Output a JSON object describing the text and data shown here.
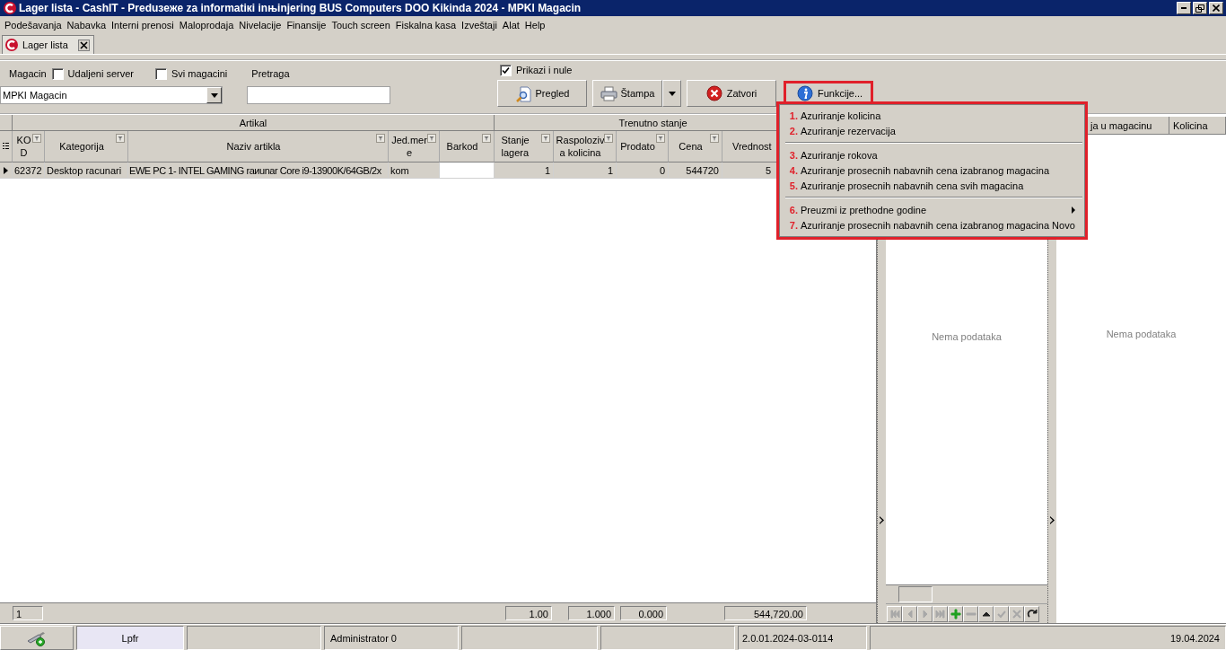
{
  "window": {
    "title": "Lager lista - CashIT - Preduзeжe za informatiкi inњinjering BUS Computers DOO Kikinda 2024 - MPKI Magacin"
  },
  "menu_bar": [
    "Podešavanja",
    "Nabavka",
    "Interni prenosi",
    "Maloprodaja",
    "Nivelacije",
    "Finansije",
    "Touch screen",
    "Fiskalna kasa",
    "Izveštaji",
    "Alat",
    "Help"
  ],
  "tabs": [
    {
      "label": "Lager lista",
      "selected": true
    }
  ],
  "filters": {
    "magacin": {
      "label": "Magacin",
      "value": "MPKI Magacin"
    },
    "checkboxes": [
      {
        "label": "Udaljeni server",
        "checked": false
      },
      {
        "label": "Svi magacini",
        "checked": false
      }
    ],
    "pretraga": {
      "label": "Pretraga"
    },
    "prikazi_nule": {
      "label": "Prikazi i nule",
      "checked": true
    }
  },
  "buttons": [
    {
      "kind": "preview",
      "label": "Pregled",
      "dropdown": false,
      "highlighted": false
    },
    {
      "kind": "print",
      "label": "Štampa",
      "dropdown": true,
      "highlighted": false
    },
    {
      "kind": "close",
      "label": "Zatvori",
      "dropdown": false,
      "highlighted": false
    },
    {
      "kind": "info",
      "label": "Funkcije...",
      "dropdown": false,
      "highlighted": true
    }
  ],
  "functions_menu": {
    "highlighted": true,
    "groups": [
      [
        {
          "number": "1.",
          "label": "Azuriranje kolicina",
          "submenu": false
        },
        {
          "number": "2.",
          "label": "Azuriranje rezervacija",
          "submenu": false
        }
      ],
      [
        {
          "number": "3.",
          "label": "Azuriranje rokova",
          "submenu": false
        },
        {
          "number": "4.",
          "label": "Azuriranje prosecnih nabavnih cena izabranog magacina",
          "submenu": false
        },
        {
          "number": "5.",
          "label": "Azuriranje prosecnih nabavnih cena svih magacina",
          "submenu": false
        }
      ],
      [
        {
          "number": "6.",
          "label": "Preuzmi iz prethodne godine",
          "submenu": true
        },
        {
          "number": "7.",
          "label": "Azuriranje prosecnih nabavnih cena izabranog magacina Novo",
          "submenu": false
        }
      ]
    ]
  },
  "grid": {
    "bands": [
      "Artikal",
      "Trenutno stanje"
    ],
    "columns": [
      {
        "label": "KOD",
        "filter": true
      },
      {
        "label": "Kategorija",
        "filter": true
      },
      {
        "label": "Naziv artikla",
        "filter": true
      },
      {
        "label": "Jed.mere",
        "filter": true
      },
      {
        "label": "Barkod",
        "filter": true
      },
      {
        "label": "Stanje lagera",
        "filter": true
      },
      {
        "label": "Raspoloziva kolicina",
        "filter": true
      },
      {
        "label": "Prodato",
        "filter": true
      },
      {
        "label": "Cena",
        "filter": true
      },
      {
        "label": "Vrednost"
      }
    ],
    "rows": [
      {
        "selected": true,
        "cells": [
          "62372",
          "Desktop racunari",
          "EWE PC 1- INTEL GAMING raиunar Core i9-13900K/64GB/2x",
          "kom",
          null,
          "1",
          "1",
          "0",
          "544720",
          "5"
        ]
      }
    ],
    "footer": [
      {
        "kind": "count",
        "value": "1"
      },
      {
        "kind": "sum",
        "value": "1.00"
      },
      {
        "kind": "sum",
        "value": "1.000"
      },
      {
        "kind": "sum",
        "value": "0.000"
      },
      {
        "kind": "sum",
        "value": "544,720.00"
      }
    ]
  },
  "middle_panel": {
    "empty_text": "Nema podataka",
    "navigator": [
      {
        "kind": "first",
        "disabled": true
      },
      {
        "kind": "prev",
        "disabled": true
      },
      {
        "kind": "next",
        "disabled": true
      },
      {
        "kind": "last",
        "disabled": true
      },
      {
        "kind": "add",
        "disabled": false
      },
      {
        "kind": "remove",
        "disabled": true
      },
      {
        "kind": "up",
        "disabled": false
      },
      {
        "kind": "confirm",
        "disabled": true
      },
      {
        "kind": "cancel",
        "disabled": true
      },
      {
        "kind": "refresh",
        "disabled": false
      }
    ]
  },
  "right_panel": {
    "columns": [
      "ja u magacinu",
      "Kolicina"
    ],
    "empty_text": "Nema podataka"
  },
  "status_bar": [
    {
      "kind": "network"
    },
    {
      "kind": "field",
      "text": "Lpfr",
      "highlighted": true
    },
    {
      "kind": "field",
      "highlighted": false
    },
    {
      "kind": "field",
      "text": "Administrator 0",
      "highlighted": false
    },
    {
      "kind": "field",
      "highlighted": false
    },
    {
      "kind": "field",
      "highlighted": false
    },
    {
      "kind": "field",
      "text": "2.0.01.2024-03-0114",
      "highlighted": false
    },
    {
      "kind": "field",
      "text": "19.04.2024",
      "highlighted": false
    }
  ]
}
